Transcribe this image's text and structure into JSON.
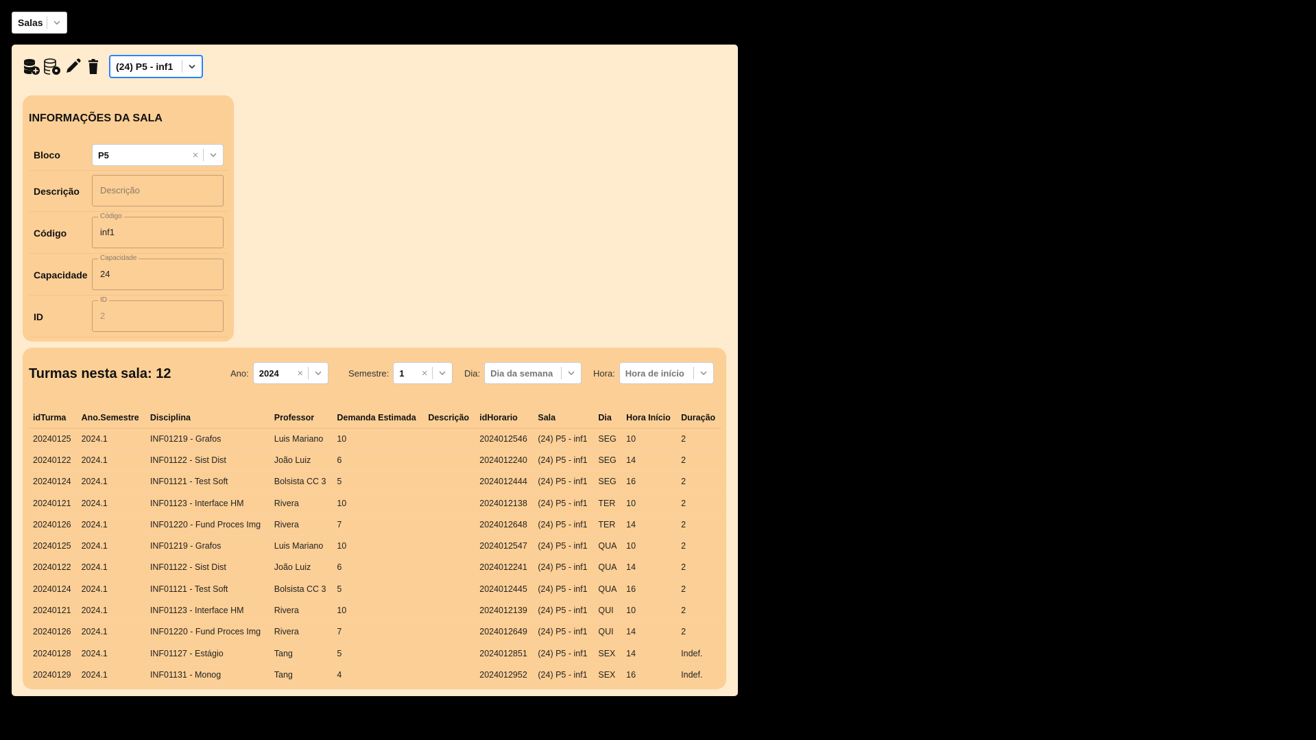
{
  "top_select": {
    "value": "Salas"
  },
  "toolbar": {
    "icons": [
      "database-add-icon",
      "database-edit-icon",
      "pencil-icon",
      "trash-icon"
    ],
    "room_select_value": "(24) P5 - inf1"
  },
  "info": {
    "title": "INFORMAÇÕES DA SALA",
    "bloco": {
      "label": "Bloco",
      "value": "P5"
    },
    "descricao": {
      "label": "Descrição",
      "placeholder": "Descrição",
      "value": ""
    },
    "codigo": {
      "label": "Código",
      "float_label": "Código",
      "value": "inf1"
    },
    "capacidade": {
      "label": "Capacidade",
      "float_label": "Capacidade",
      "value": "24"
    },
    "id": {
      "label": "ID",
      "float_label": "ID",
      "value": "2"
    }
  },
  "classes": {
    "title": "Turmas nesta sala: 12",
    "filters": {
      "ano": {
        "label": "Ano:",
        "value": "2024"
      },
      "semestre": {
        "label": "Semestre:",
        "value": "1"
      },
      "dia": {
        "label": "Dia:",
        "placeholder": "Dia da semana"
      },
      "hora": {
        "label": "Hora:",
        "placeholder": "Hora de início"
      }
    },
    "columns": [
      "idTurma",
      "Ano.Semestre",
      "Disciplina",
      "Professor",
      "Demanda Estimada",
      "Descrição",
      "idHorario",
      "Sala",
      "Dia",
      "Hora Início",
      "Duração"
    ],
    "rows": [
      [
        "20240125",
        "2024.1",
        "INF01219 - Grafos",
        "Luis Mariano",
        "10",
        "",
        "2024012546",
        "(24) P5 - inf1",
        "SEG",
        "10",
        "2"
      ],
      [
        "20240122",
        "2024.1",
        "INF01122 - Sist Dist",
        "João Luiz",
        "6",
        "",
        "2024012240",
        "(24) P5 - inf1",
        "SEG",
        "14",
        "2"
      ],
      [
        "20240124",
        "2024.1",
        "INF01121 - Test Soft",
        "Bolsista CC 3",
        "5",
        "",
        "2024012444",
        "(24) P5 - inf1",
        "SEG",
        "16",
        "2"
      ],
      [
        "20240121",
        "2024.1",
        "INF01123 - Interface HM",
        "Rivera",
        "10",
        "",
        "2024012138",
        "(24) P5 - inf1",
        "TER",
        "10",
        "2"
      ],
      [
        "20240126",
        "2024.1",
        "INF01220 - Fund Proces Img",
        "Rivera",
        "7",
        "",
        "2024012648",
        "(24) P5 - inf1",
        "TER",
        "14",
        "2"
      ],
      [
        "20240125",
        "2024.1",
        "INF01219 - Grafos",
        "Luis Mariano",
        "10",
        "",
        "2024012547",
        "(24) P5 - inf1",
        "QUA",
        "10",
        "2"
      ],
      [
        "20240122",
        "2024.1",
        "INF01122 - Sist Dist",
        "João Luiz",
        "6",
        "",
        "2024012241",
        "(24) P5 - inf1",
        "QUA",
        "14",
        "2"
      ],
      [
        "20240124",
        "2024.1",
        "INF01121 - Test Soft",
        "Bolsista CC 3",
        "5",
        "",
        "2024012445",
        "(24) P5 - inf1",
        "QUA",
        "16",
        "2"
      ],
      [
        "20240121",
        "2024.1",
        "INF01123 - Interface HM",
        "Rivera",
        "10",
        "",
        "2024012139",
        "(24) P5 - inf1",
        "QUI",
        "10",
        "2"
      ],
      [
        "20240126",
        "2024.1",
        "INF01220 - Fund Proces Img",
        "Rivera",
        "7",
        "",
        "2024012649",
        "(24) P5 - inf1",
        "QUI",
        "14",
        "2"
      ],
      [
        "20240128",
        "2024.1",
        "INF01127 - Estágio",
        "Tang",
        "5",
        "",
        "2024012851",
        "(24) P5 - inf1",
        "SEX",
        "14",
        "Indef."
      ],
      [
        "20240129",
        "2024.1",
        "INF01131 - Monog",
        "Tang",
        "4",
        "",
        "2024012952",
        "(24) P5 - inf1",
        "SEX",
        "16",
        "Indef."
      ]
    ]
  },
  "colors": {
    "page_bg": "#000000",
    "panel_bg": "#ffebcd",
    "card_bg": "#fccf96",
    "focus_border": "#2684ff"
  }
}
